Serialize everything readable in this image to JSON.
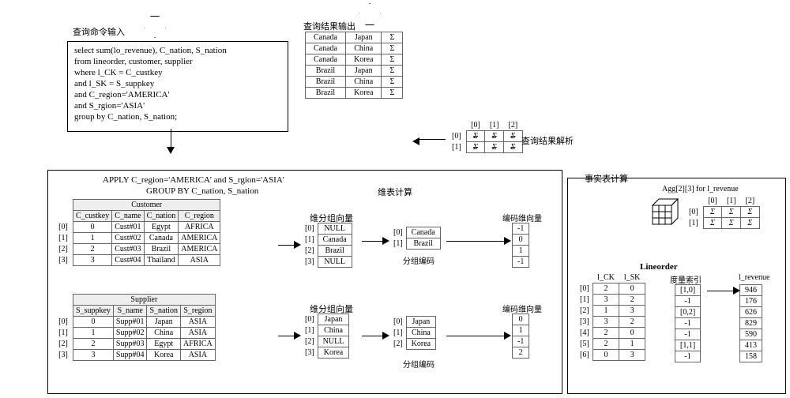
{
  "labels": {
    "query_input": "查询命令输入",
    "result_output": "查询结果输出",
    "dim_table_calc": "维表计算",
    "fact_table_calc": "事实表计算",
    "dim_group_vec": "维分组向量",
    "group_code": "分组编码",
    "code_dim_vec": "编码维向量",
    "result_parse": "查询结果解析",
    "measure_index": "度量索引",
    "apply": "APPLY C_region='AMERICA' and S_rgion='ASIA'",
    "groupby": "GROUP BY C_nation, S_nation",
    "agg_title": "Agg[2][3] for l_revenue"
  },
  "sql": [
    "select sum(lo_revenue), C_nation, S_nation",
    "from lineorder, customer, supplier",
    "where l_CK = C_custkey",
    "and l_SK = S_suppkey",
    "and C_region='AMERICA'",
    "and S_rgion='ASIA'",
    "group by C_nation, S_nation;"
  ],
  "customer": {
    "title": "Customer",
    "headers": [
      "C_custkey",
      "C_name",
      "C_nation",
      "C_region"
    ],
    "idx": [
      "[0]",
      "[1]",
      "[2]",
      "[3]"
    ],
    "rows": [
      [
        "0",
        "Cust#01",
        "Egypt",
        "AFRICA"
      ],
      [
        "1",
        "Cust#02",
        "Canada",
        "AMERICA"
      ],
      [
        "2",
        "Cust#03",
        "Brazil",
        "AMERICA"
      ],
      [
        "3",
        "Cust#04",
        "Thailand",
        "ASIA"
      ]
    ]
  },
  "supplier": {
    "title": "Supplier",
    "headers": [
      "S_suppkey",
      "S_name",
      "S_nation",
      "S_region"
    ],
    "idx": [
      "[0]",
      "[1]",
      "[2]",
      "[3]"
    ],
    "rows": [
      [
        "0",
        "Supp#01",
        "Japan",
        "ASIA"
      ],
      [
        "1",
        "Supp#02",
        "China",
        "ASIA"
      ],
      [
        "2",
        "Supp#03",
        "Egypt",
        "AFRICA"
      ],
      [
        "3",
        "Supp#04",
        "Korea",
        "ASIA"
      ]
    ]
  },
  "dimvec_c": {
    "idx": [
      "[0]",
      "[1]",
      "[2]",
      "[3]"
    ],
    "vals": [
      "NULL",
      "Canada",
      "Brazil",
      "NULL"
    ]
  },
  "dimvec_s": {
    "idx": [
      "[0]",
      "[1]",
      "[2]",
      "[3]"
    ],
    "vals": [
      "Japan",
      "China",
      "NULL",
      "Korea"
    ]
  },
  "groupcode_c": {
    "idx": [
      "[0]",
      "[1]"
    ],
    "vals": [
      "Canada",
      "Brazil"
    ]
  },
  "groupcode_s": {
    "idx": [
      "[0]",
      "[1]",
      "[2]"
    ],
    "vals": [
      "Japan",
      "China",
      "Korea"
    ]
  },
  "codevec_c": {
    "vals": [
      "-1",
      "0",
      "1",
      "-1"
    ]
  },
  "codevec_s": {
    "vals": [
      "0",
      "1",
      "-1",
      "2"
    ]
  },
  "lineorder": {
    "title": "Lineorder",
    "headers": [
      "l_CK",
      "l_SK"
    ],
    "mheader": "l_revenue",
    "idx": [
      "[0]",
      "[1]",
      "[2]",
      "[3]",
      "[4]",
      "[5]",
      "[6]"
    ],
    "rows": [
      [
        "2",
        "0"
      ],
      [
        "3",
        "2"
      ],
      [
        "1",
        "3"
      ],
      [
        "3",
        "2"
      ],
      [
        "2",
        "0"
      ],
      [
        "2",
        "1"
      ],
      [
        "0",
        "3"
      ]
    ],
    "meas_idx": [
      "[1,0]",
      "-1",
      "[0,2]",
      "-1",
      "-1",
      "[1,1]",
      "-1"
    ],
    "revenue": [
      "946",
      "176",
      "626",
      "829",
      "590",
      "413",
      "158"
    ]
  },
  "parse_matrix": {
    "cols": [
      "[0]",
      "[1]",
      "[2]"
    ],
    "rows": [
      "[0]",
      "[1]"
    ],
    "vals": [
      [
        "Σ",
        "Σ",
        "Σ"
      ],
      [
        "Σ",
        "Σ",
        "Σ"
      ]
    ]
  },
  "agg_matrix": {
    "cols": [
      "[0]",
      "[1]",
      "[2]"
    ],
    "rows": [
      "[0]",
      "[1]"
    ],
    "vals": [
      [
        "Σ",
        "Σ",
        "Σ"
      ],
      [
        "Σ",
        "Σ",
        "Σ"
      ]
    ]
  },
  "output": {
    "rows": [
      [
        "Canada",
        "Japan",
        "Σ"
      ],
      [
        "Canada",
        "China",
        "Σ"
      ],
      [
        "Canada",
        "Korea",
        "Σ"
      ],
      [
        "Brazil",
        "Japan",
        "Σ"
      ],
      [
        "Brazil",
        "China",
        "Σ"
      ],
      [
        "Brazil",
        "Korea",
        "Σ"
      ]
    ]
  }
}
